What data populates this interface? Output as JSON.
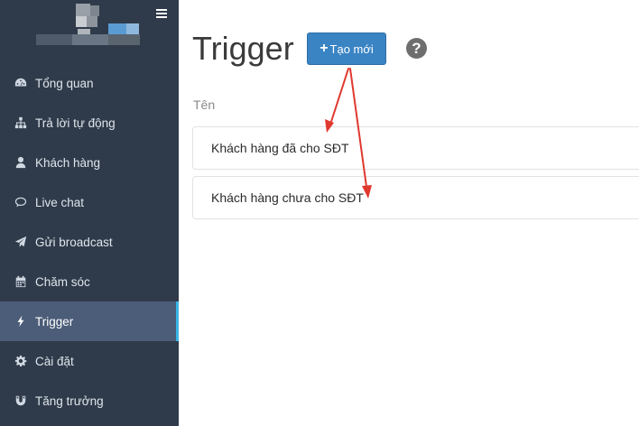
{
  "page_title": "Trigger",
  "new_button_label": "Tạo mới",
  "help_icon_glyph": "?",
  "table": {
    "column_name": "Tên",
    "rows": [
      "Khách hàng đã cho SĐT",
      "Khách hàng chưa cho SĐT"
    ]
  },
  "sidebar": {
    "items": [
      {
        "label": "Tổng quan",
        "icon": "dashboard-icon"
      },
      {
        "label": "Trả lời tự động",
        "icon": "sitemap-icon"
      },
      {
        "label": "Khách hàng",
        "icon": "user-icon"
      },
      {
        "label": "Live chat",
        "icon": "chat-bubble-icon"
      },
      {
        "label": "Gửi broadcast",
        "icon": "paper-plane-icon"
      },
      {
        "label": "Chăm sóc",
        "icon": "calendar-icon"
      },
      {
        "label": "Trigger",
        "icon": "bolt-icon",
        "active": true
      },
      {
        "label": "Cài đặt",
        "icon": "gear-icon"
      },
      {
        "label": "Tăng trưởng",
        "icon": "magnet-icon"
      }
    ]
  },
  "colors": {
    "sidebar_bg": "#2f3b4a",
    "active_item_bg": "#4b5d78",
    "active_indicator": "#38b5e8",
    "primary_button": "#3a84c4",
    "annotation_arrow": "#e0392f"
  }
}
